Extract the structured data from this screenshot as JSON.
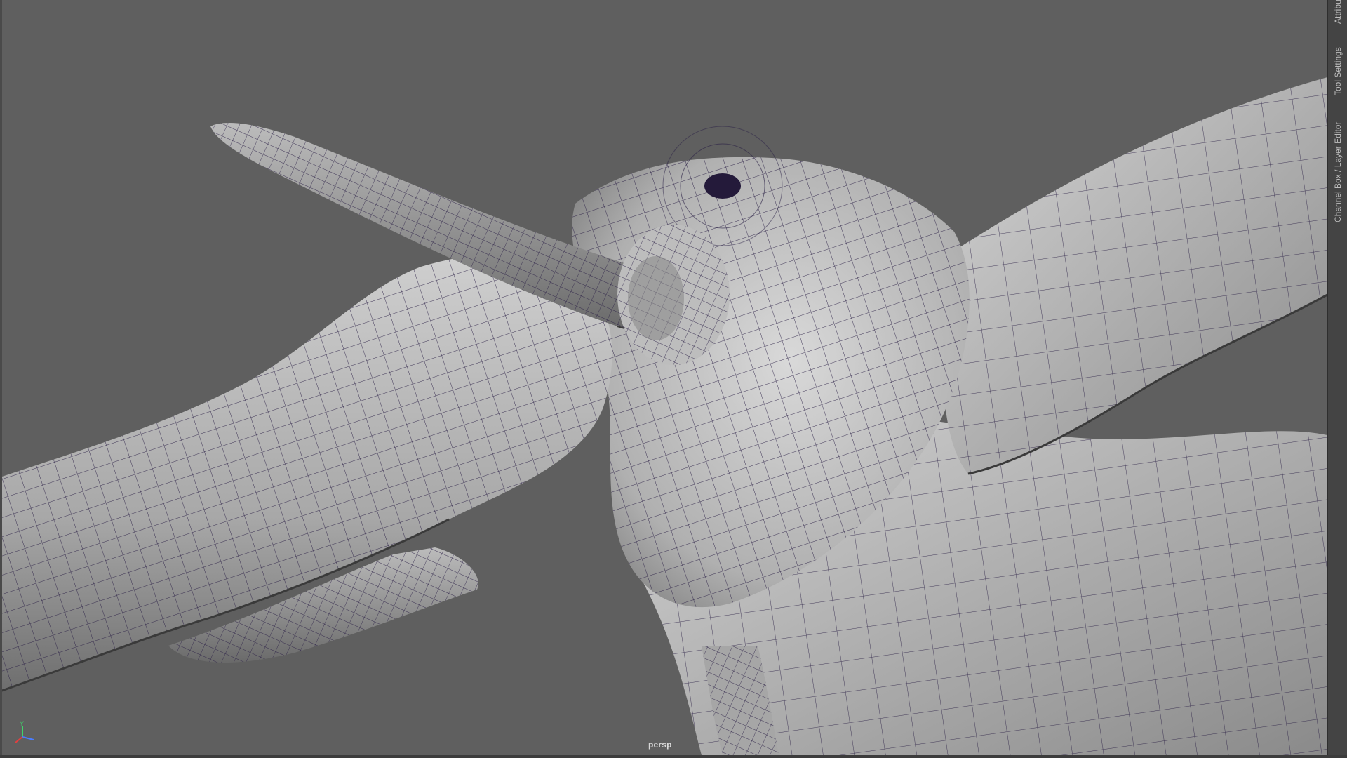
{
  "viewport": {
    "camera_label": "persp",
    "background_color": "#5f5f5f",
    "model": {
      "description_icon": "mesh-wireframe-on-shaded",
      "surface_color": "#b4b4b4",
      "wire_color": "#2a1f45"
    }
  },
  "axis_gizmo": {
    "y_label": "Y",
    "x_color": "#e04040",
    "y_color": "#3fd46a",
    "z_color": "#4a7dff"
  },
  "right_panel": {
    "tabs": [
      {
        "label": "Attribu"
      },
      {
        "label": "Tool Settings"
      },
      {
        "label": "Channel Box / Layer Editor"
      }
    ]
  }
}
